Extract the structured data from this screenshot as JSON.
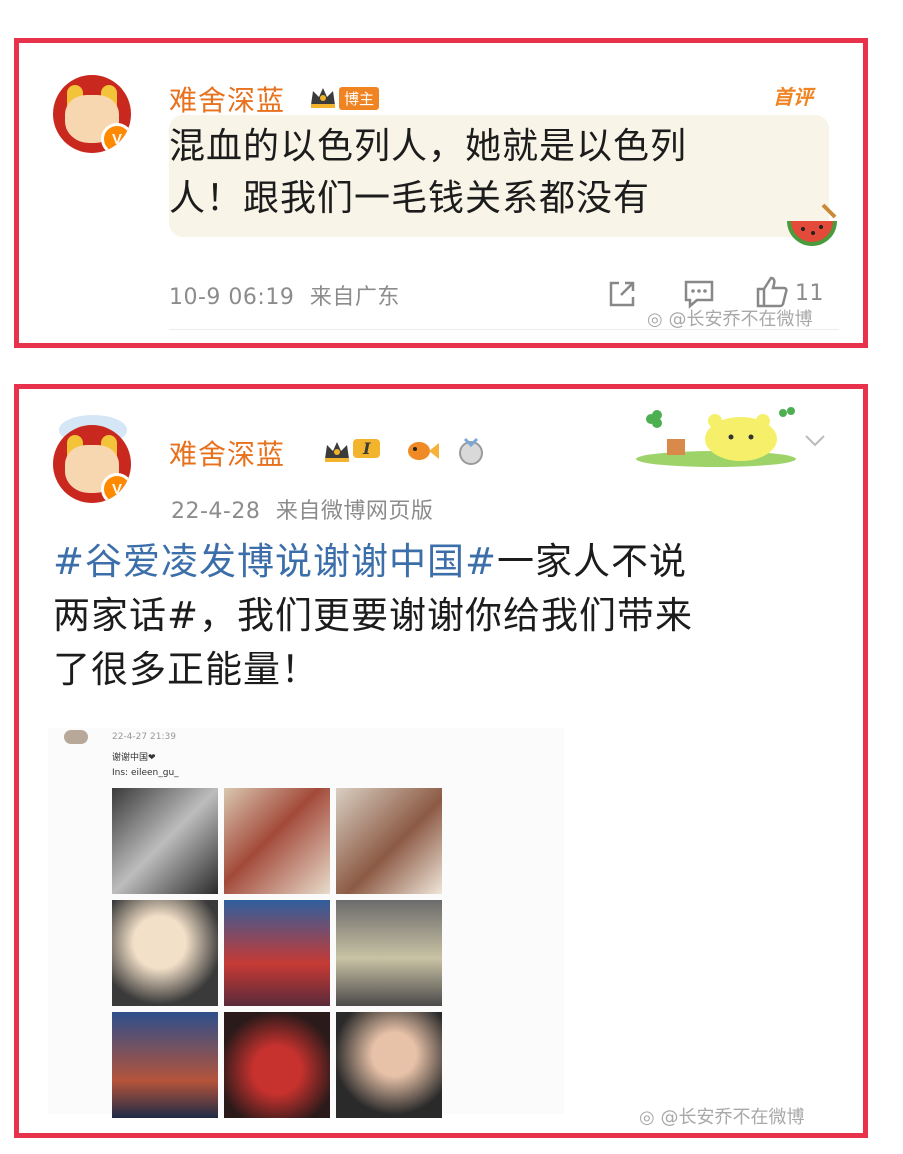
{
  "post1": {
    "username": "难舍深蓝",
    "badge": "博主",
    "first_comment_tag": "首评",
    "text": "混血的以色列人，她就是以色列人！跟我们一毛钱关系都没有",
    "text_line1": "混血的以色列人，她就是以色列",
    "text_line2": "人！跟我们一毛钱关系都没有",
    "timestamp": "10-9 06:19",
    "source": "来自广东",
    "like_count": "11",
    "watermark": "@长安乔不在微博"
  },
  "post2": {
    "username": "难舍深蓝",
    "level_badge": "I",
    "timestamp": "22-4-28",
    "source": "来自微博网页版",
    "topic": "#谷爱凌发博说谢谢中国#",
    "text_after_topic_line1": "一家人不说",
    "text_line2": "两家话#，我们更要谢谢你给我们带来",
    "text_line3": "了很多正能量！",
    "embedded": {
      "timestamp": "22-4-27 21:39",
      "caption": "谢谢中国❤",
      "ins": "Ins: eileen_gu_"
    },
    "watermark": "@长安乔不在微博"
  },
  "colors": {
    "frame": "#e8314a",
    "username": "#e8711e",
    "topic": "#3c6faa",
    "meta": "#8c8c8c"
  }
}
